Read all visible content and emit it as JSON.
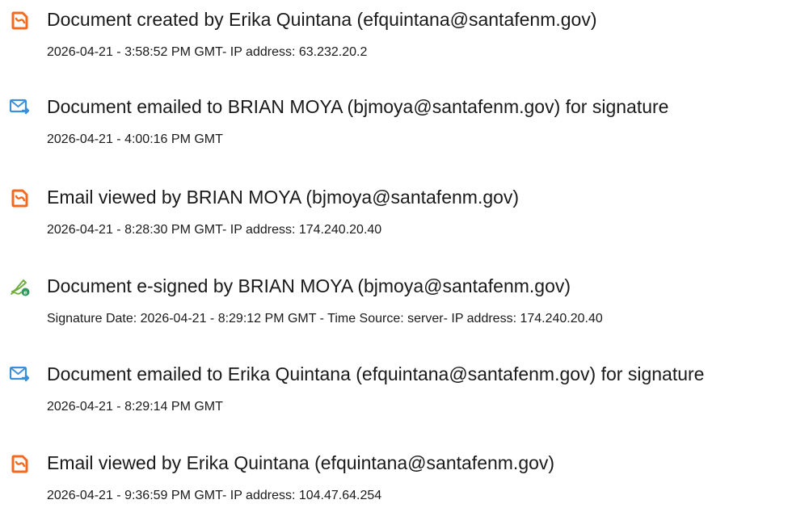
{
  "colors": {
    "pdf_icon": "#f2691f",
    "email_icon": "#3a8fd9",
    "sign_icon": "#2f9a5e",
    "text": "#1a1a1a"
  },
  "events": [
    {
      "icon": "document-icon",
      "title": "Document created by Erika Quintana (efquintana@santafenm.gov)",
      "detail": "2026-04-21 - 3:58:52 PM GMT- IP address: 63.232.20.2"
    },
    {
      "icon": "email-icon",
      "title": "Document emailed to BRIAN MOYA (bjmoya@santafenm.gov) for signature",
      "detail": "2026-04-21 - 4:00:16 PM GMT"
    },
    {
      "icon": "document-icon",
      "title": "Email viewed by BRIAN MOYA (bjmoya@santafenm.gov)",
      "detail": "2026-04-21 - 8:28:30 PM GMT- IP address: 174.240.20.40"
    },
    {
      "icon": "esign-icon",
      "title": "Document e-signed by BRIAN MOYA (bjmoya@santafenm.gov)",
      "detail": "Signature Date: 2026-04-21 - 8:29:12 PM GMT - Time Source: server- IP address: 174.240.20.40"
    },
    {
      "icon": "email-icon",
      "title": "Document emailed to Erika Quintana (efquintana@santafenm.gov) for signature",
      "detail": "2026-04-21 - 8:29:14 PM GMT"
    },
    {
      "icon": "document-icon",
      "title": "Email viewed by Erika Quintana (efquintana@santafenm.gov)",
      "detail": "2026-04-21 - 9:36:59 PM GMT- IP address: 104.47.64.254"
    }
  ]
}
